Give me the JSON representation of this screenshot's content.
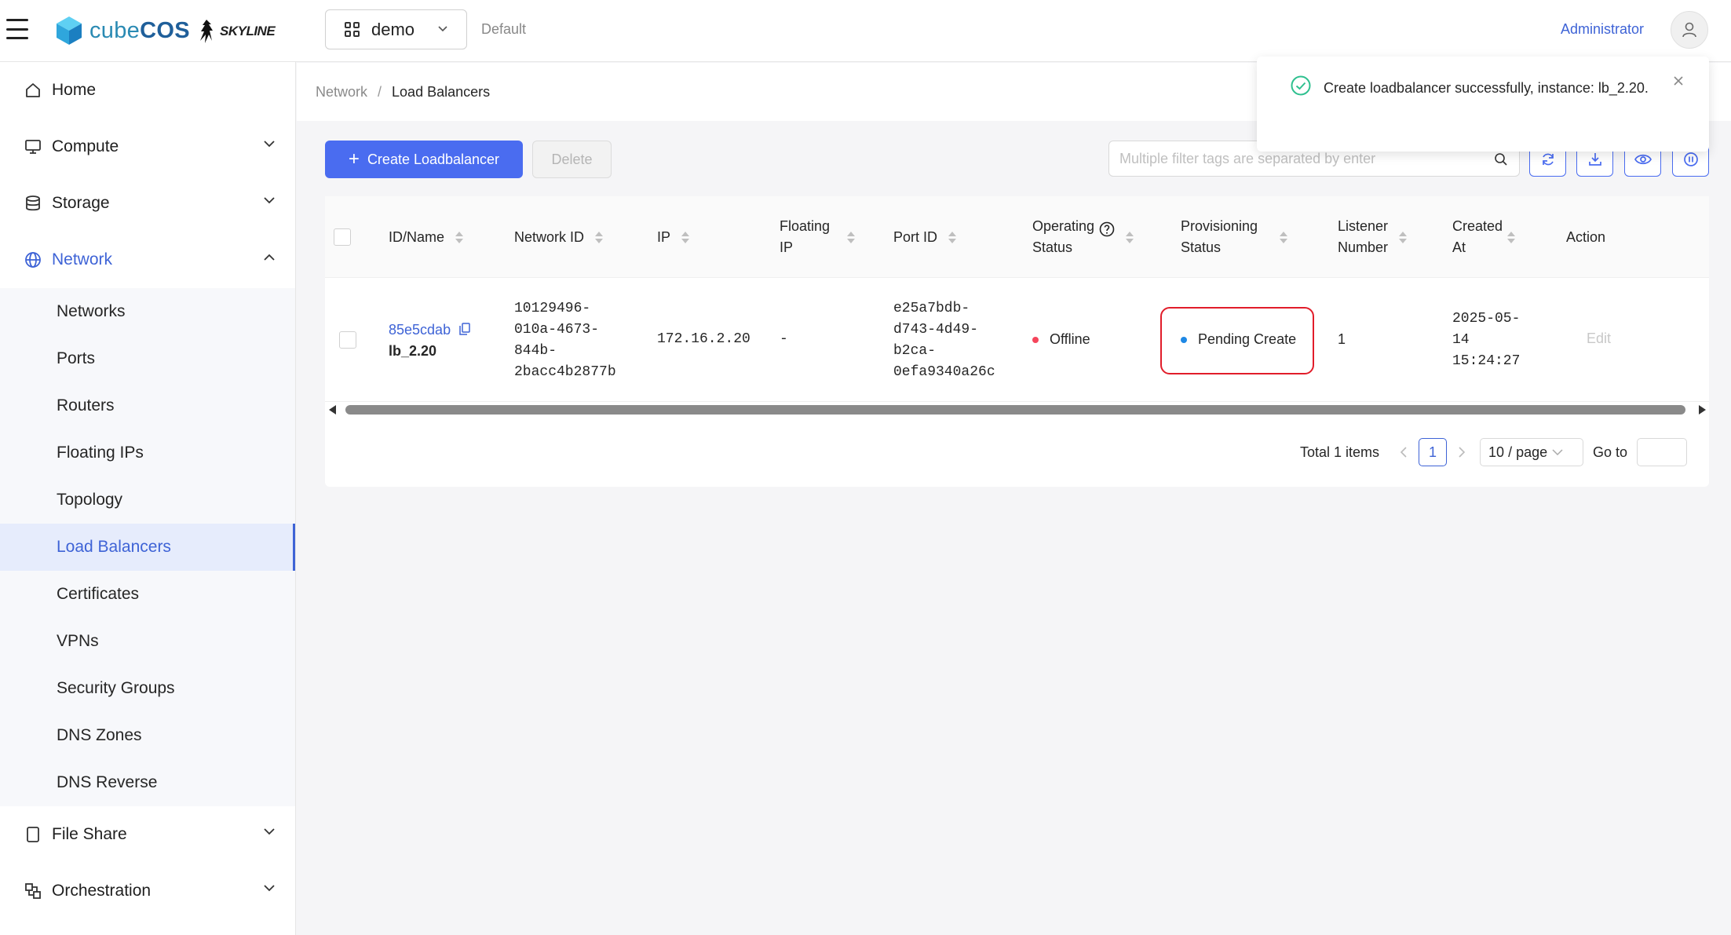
{
  "header": {
    "brand_light": "cube",
    "brand_bold": "COS",
    "partner": "SKYLINE",
    "project": "demo",
    "domain": "Default",
    "user": "Administrator"
  },
  "sidebar": {
    "items": [
      {
        "label": "Home",
        "icon": "home-icon"
      },
      {
        "label": "Compute",
        "icon": "monitor-icon"
      },
      {
        "label": "Storage",
        "icon": "database-icon"
      },
      {
        "label": "Network",
        "icon": "globe-icon"
      },
      {
        "label": "File Share",
        "icon": "file-icon"
      },
      {
        "label": "Orchestration",
        "icon": "orchestration-icon"
      }
    ],
    "network_sub": [
      "Networks",
      "Ports",
      "Routers",
      "Floating IPs",
      "Topology",
      "Load Balancers",
      "Certificates",
      "VPNs",
      "Security Groups",
      "DNS Zones",
      "DNS Reverse"
    ],
    "selected_sub": "Load Balancers"
  },
  "breadcrumb": {
    "parent": "Network",
    "current": "Load Balancers"
  },
  "toolbar": {
    "create_label": "Create Loadbalancer",
    "delete_label": "Delete",
    "search_placeholder": "Multiple filter tags are separated by enter",
    "tools": [
      "refresh-icon",
      "download-icon",
      "eye-icon",
      "pause-icon"
    ]
  },
  "table": {
    "headers": {
      "id_name": "ID/Name",
      "network_id": "Network ID",
      "ip": "IP",
      "floating_ip_1": "Floating",
      "floating_ip_2": "IP",
      "port_id": "Port ID",
      "op_status_1": "Operating",
      "op_status_2": "Status",
      "prov_status_1": "Provisioning",
      "prov_status_2": "Status",
      "listener_1": "Listener",
      "listener_2": "Number",
      "created_1": "Created",
      "created_2": "At",
      "action": "Action"
    },
    "rows": [
      {
        "id": "85e5cdab",
        "name": "lb_2.20",
        "network_id": [
          "10129496-",
          "010a-4673-",
          "844b-",
          "2bacc4b2877b"
        ],
        "ip": "172.16.2.20",
        "floating_ip": "-",
        "port_id": [
          "e25a7bdb-",
          "d743-4d49-",
          "b2ca-",
          "0efa9340a26c"
        ],
        "operating_status": "Offline",
        "provisioning_status": "Pending Create",
        "listener_number": "1",
        "created_at": [
          "2025-05-",
          "14",
          "15:24:27"
        ],
        "action": "Edit"
      }
    ]
  },
  "pagination": {
    "total": "Total 1 items",
    "current_page": "1",
    "page_size": "10 / page",
    "goto_label": "Go to"
  },
  "toast": {
    "message": "Create loadbalancer successfully, instance: lb_2.20."
  },
  "colors": {
    "primary": "#4a6cf0",
    "offline": "#f5455b",
    "pending": "#1e88e5",
    "highlight": "#e11d2a"
  }
}
